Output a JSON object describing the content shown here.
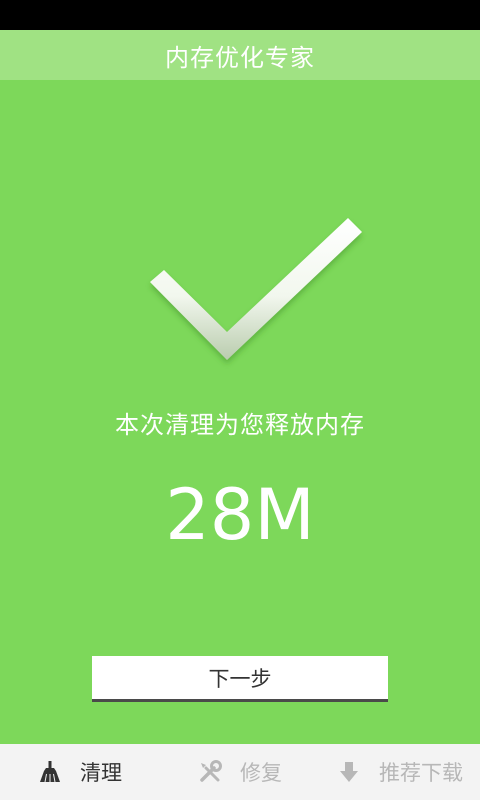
{
  "app": {
    "title": "内存优化专家"
  },
  "result": {
    "message": "本次清理为您释放内存",
    "amount": "28M",
    "next_label": "下一步"
  },
  "nav": {
    "items": [
      {
        "label": "清理",
        "icon": "broom-icon",
        "active": true
      },
      {
        "label": "修复",
        "icon": "wrench-screwdriver-icon",
        "active": false
      },
      {
        "label": "推荐下载",
        "icon": "download-arrow-icon",
        "active": false
      }
    ]
  },
  "colors": {
    "background": "#7dd85a",
    "titlebar": "#a0e283",
    "text_light": "#ffffff",
    "nav_active": "#333333",
    "nav_inactive": "#b7b7b7"
  }
}
